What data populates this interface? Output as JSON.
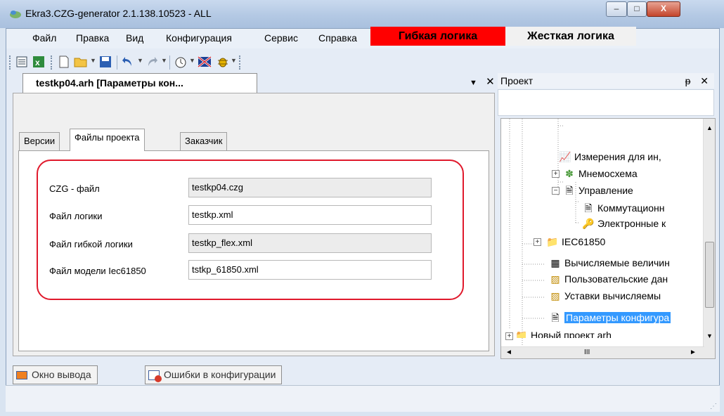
{
  "window": {
    "title": "Ekra3.CZG-generator 2.1.138.10523 - ALL",
    "controls": {
      "minimize": "–",
      "maximize": "□",
      "close": "X"
    }
  },
  "menu": [
    "Файл",
    "Правка",
    "Вид",
    "Конфигурация",
    "Сервис",
    "Справка"
  ],
  "toolbar": {
    "icons": [
      "list-icon",
      "excel-icon",
      "new-file-icon",
      "open-folder-icon",
      "save-icon",
      "undo-icon",
      "redo-icon",
      "timer-icon",
      "flag-icon",
      "bug-icon"
    ],
    "flex_logic_label": "Гибкая логика",
    "hard_logic_label": "Жесткая логика",
    "flex_color": "#ff0000"
  },
  "document": {
    "tab_title": "testkp04.arh [Параметры кон...",
    "controls": {
      "dropdown": "▼",
      "close": "✕"
    },
    "inner_tabs": [
      "Версии",
      "Файлы проекта",
      "Заказчик"
    ],
    "active_inner_tab": "Файлы проекта",
    "fields": [
      {
        "label": "CZG - файл",
        "value": "testkp04.czg",
        "readonly": true
      },
      {
        "label": "Файл логики",
        "value": "testkp.xml",
        "readonly": false
      },
      {
        "label": "Файл гибкой логики",
        "value": "testkp_flex.xml",
        "readonly": true
      },
      {
        "label": "Файл модели Iec61850",
        "value": "tstkp_61850.xml",
        "readonly": false
      }
    ],
    "highlight_color": "#e0192c"
  },
  "project": {
    "title": "Проект",
    "controls": {
      "pin": "ᵽ",
      "close": "✕"
    },
    "tree": [
      {
        "label": "Измерения для ин,",
        "icon": "chart-icon"
      },
      {
        "label": "Мнемосхема",
        "icon": "graph-icon",
        "expander": "+"
      },
      {
        "label": "Управление",
        "icon": "document-icon",
        "expander": "−"
      },
      {
        "label": "Коммутационн",
        "icon": "document-icon"
      },
      {
        "label": "Электронные к",
        "icon": "key-icon"
      },
      {
        "label": "IEC61850",
        "icon": "folder-icon",
        "expander": "+"
      },
      {
        "label": "Вычисляемые величин",
        "icon": "calculator-icon"
      },
      {
        "label": "Пользовательские дан",
        "icon": "user-data-icon"
      },
      {
        "label": "Уставки вычисляемы",
        "icon": "user-data-icon"
      },
      {
        "label": "Параметры конфигура",
        "icon": "document-icon",
        "selected": true
      },
      {
        "label": "Новый проект arh",
        "icon": "folder-icon",
        "expander": "+"
      }
    ],
    "hscroll_thumb_text": "III"
  },
  "bottom_tabs": [
    {
      "label": "Окно вывода",
      "icon": "output-window-icon"
    },
    {
      "label": "Ошибки в конфигурации",
      "icon": "error-config-icon"
    }
  ]
}
